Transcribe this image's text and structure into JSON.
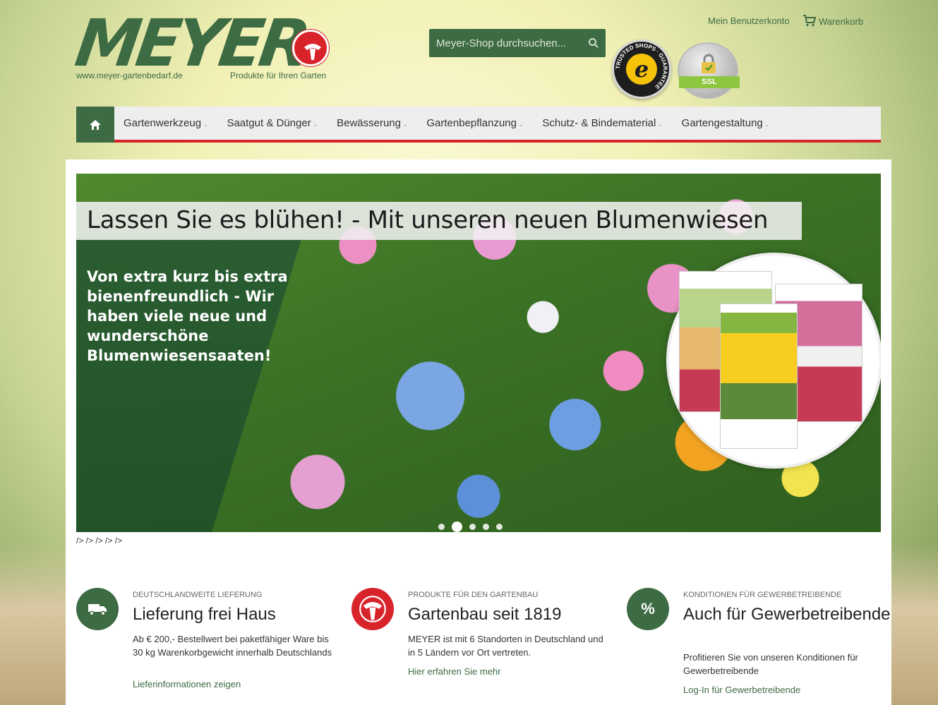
{
  "brand": {
    "logo_text": "MEYER",
    "url": "www.meyer-gartenbedarf.de",
    "claim": "Produkte für Ihren Garten"
  },
  "search": {
    "placeholder": "Meyer-Shop durchsuchen..."
  },
  "header": {
    "account": "Mein Benutzerkonto",
    "cart": "Warenkorb"
  },
  "badges": {
    "trusted": "e",
    "trusted_ring": "TRUSTED SHOPS · GUARANTEE",
    "ssl": "SSL"
  },
  "nav": {
    "items": [
      {
        "label": "Gartenwerkzeug"
      },
      {
        "label": "Saatgut & Dünger"
      },
      {
        "label": "Bewässerung"
      },
      {
        "label": "Gartenbepflanzung"
      },
      {
        "label": "Schutz- & Bindematerial"
      },
      {
        "label": "Gartengestaltung"
      }
    ]
  },
  "slider": {
    "headline": "Lassen Sie es blühen! - Mit unseren neuen Blumenwiesen",
    "subtext": "Von extra kurz bis extra bienenfreundlich - Wir haben viele neue und wunderschöne Blumenwiesensaaten!",
    "slide_count": 5,
    "active_slide": 2
  },
  "crumb": "/> /> /> /> />",
  "features": [
    {
      "icon": "truck-icon",
      "kicker": "DEUTSCHLANDWEITE LIEFERUNG",
      "title": "Lieferung frei Haus",
      "text": "Ab € 200,- Bestellwert bei paketfähiger Ware bis 30 kg Warenkorbgewicht innerhalb Deutschlands",
      "link": "Lieferinformationen zeigen"
    },
    {
      "icon": "meyer-logo-icon",
      "kicker": "PRODUKTE FÜR DEN GARTENBAU",
      "title": "Gartenbau seit 1819",
      "text": "MEYER ist mit 6 Standorten in Deutschland und in 5 Ländern vor Ort vertreten.",
      "link": "Hier erfahren Sie mehr"
    },
    {
      "icon": "percent-icon",
      "icon_text": "%",
      "kicker": "KONDITIONEN FÜR GEWERBETREIBENDE",
      "title": "Auch für Gewerbetreibende",
      "text": "Profitieren Sie von unseren Konditionen für Gewerbetreibende",
      "link": "Log-In für Gewerbetreibende"
    }
  ],
  "colors": {
    "primary": "#3d6b43",
    "accent": "#d8232a"
  }
}
